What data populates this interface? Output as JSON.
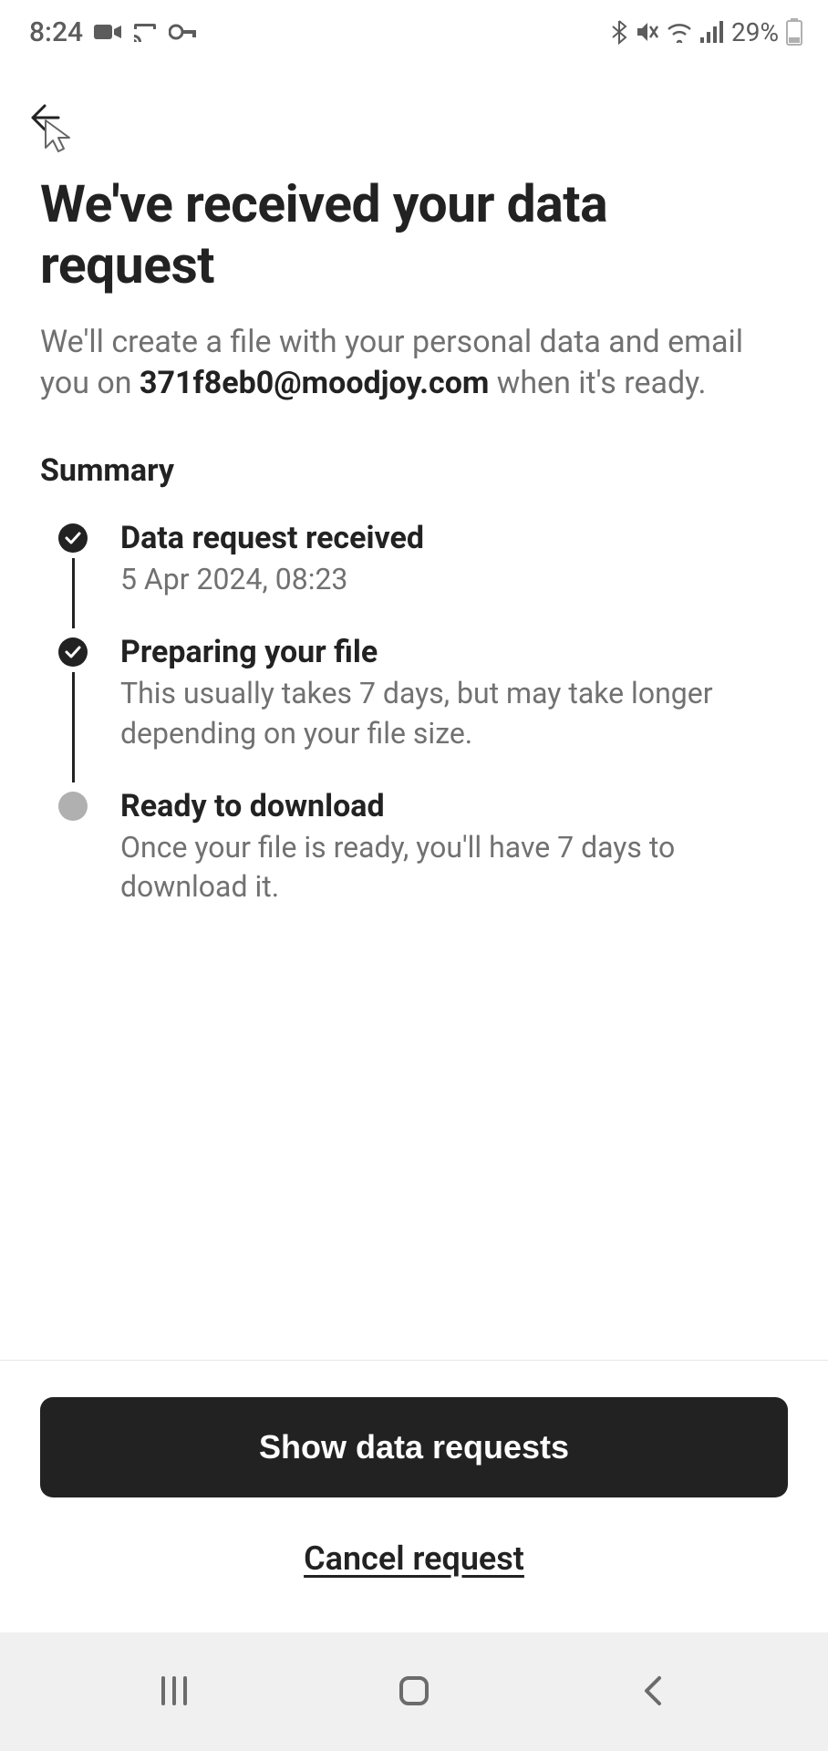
{
  "status_bar": {
    "time": "8:24",
    "battery": "29%"
  },
  "page": {
    "title": "We've received your data request",
    "subtitle_prefix": "We'll create a file with your personal data and email you on ",
    "subtitle_email": "371f8eb0@moodjoy.com",
    "subtitle_suffix": " when it's ready.",
    "summary_label": "Summary"
  },
  "timeline": {
    "items": [
      {
        "status": "done",
        "title": "Data request received",
        "desc": "5 Apr 2024, 08:23"
      },
      {
        "status": "done",
        "title": "Preparing your file",
        "desc": "This usually takes 7 days, but may take longer depending on your file size."
      },
      {
        "status": "pending",
        "title": "Ready to download",
        "desc": "Once your file is ready, you'll have 7 days to download it."
      }
    ]
  },
  "footer": {
    "primary_button": "Show data requests",
    "secondary_link": "Cancel request"
  }
}
